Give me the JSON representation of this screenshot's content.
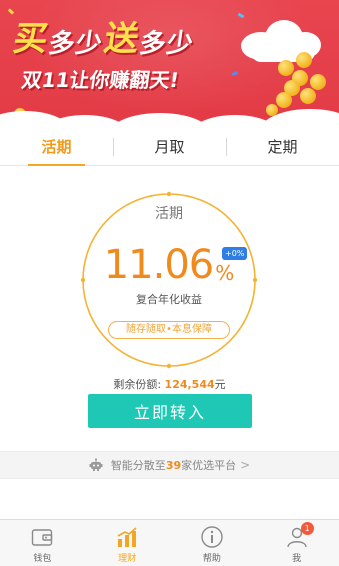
{
  "banner": {
    "line1_part1": "买",
    "line1_part2": "多少",
    "line1_part3": "送",
    "line1_part4": "多少",
    "line2": "双11让你赚翻天!",
    "colors": {
      "background": "#e23b46",
      "headline_accent": "#ffe14a",
      "coin": "#f0b21c"
    }
  },
  "tabs": [
    {
      "label": "活期",
      "active": true
    },
    {
      "label": "月取",
      "active": false
    },
    {
      "label": "定期",
      "active": false
    }
  ],
  "product": {
    "title": "活期",
    "rate": "11.06",
    "rate_unit": "%",
    "bonus": "+0%",
    "rate_label": "复合年化收益",
    "feature": "随存随取•本息保障"
  },
  "remaining": {
    "label": "剩余份额:",
    "value": "124,544",
    "unit": "元"
  },
  "cta": {
    "label": "立即转入",
    "color": "#1ec8b4"
  },
  "platform_strip": {
    "prefix": "智能分散至",
    "count": "39",
    "suffix": "家优选平台",
    "chevron": ">"
  },
  "nav": {
    "items": [
      {
        "label": "钱包",
        "icon": "wallet-icon",
        "active": false
      },
      {
        "label": "理财",
        "icon": "bar-chart-icon",
        "active": true
      },
      {
        "label": "帮助",
        "icon": "info-icon",
        "active": false
      },
      {
        "label": "我",
        "icon": "user-icon",
        "active": false,
        "badge": "1"
      }
    ]
  },
  "accent_color": "#f29b1a"
}
